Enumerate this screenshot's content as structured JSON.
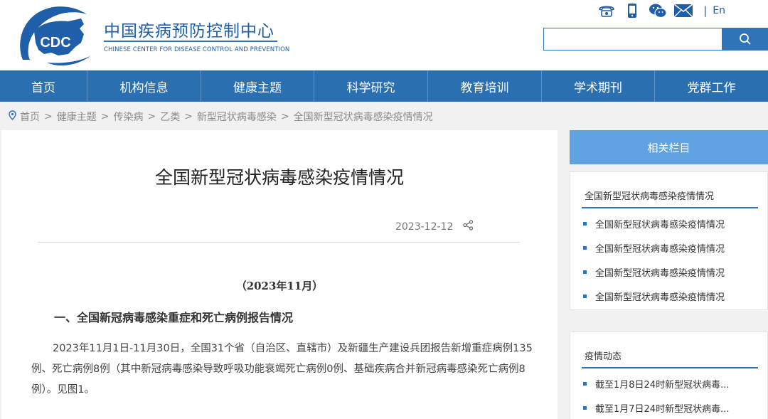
{
  "header": {
    "logo_text": "CDC",
    "org_name_cn": "中国疾病预防控制中心",
    "org_name_en": "CHINESE CENTER FOR DISEASE CONTROL AND PREVENTION",
    "lang_separator": "|",
    "lang_link": "En",
    "icons": [
      "phone-icon",
      "mobile-icon",
      "wechat-icon",
      "mail-icon"
    ],
    "search_placeholder": ""
  },
  "nav": {
    "items": [
      {
        "label": "首页"
      },
      {
        "label": "机构信息"
      },
      {
        "label": "健康主题"
      },
      {
        "label": "科学研究"
      },
      {
        "label": "教育培训"
      },
      {
        "label": "学术期刊"
      },
      {
        "label": "党群工作"
      }
    ]
  },
  "breadcrumb": {
    "separator": ">",
    "items": [
      "首页",
      "健康主题",
      "传染病",
      "乙类",
      "新型冠状病毒感染",
      "全国新型冠状病毒感染疫情情况"
    ]
  },
  "article": {
    "title": "全国新型冠状病毒感染疫情情况",
    "date": "2023-12-12",
    "subdate": "（2023年11月）",
    "section1_heading": "一、全国新冠病毒感染重症和死亡病例报告情况",
    "paragraph1": "2023年11月1日-11月30日，全国31个省（自治区、直辖市）及新疆生产建设兵团报告新增重症病例135例、死亡病例8例（其中新冠病毒感染导致呼吸功能衰竭死亡病例0例、基础疾病合并新冠病毒感染死亡病例8例）。见图1。"
  },
  "sidebar": {
    "header": "相关栏目",
    "box1": {
      "title": "全国新型冠状病毒感染疫情情况",
      "items": [
        "全国新型冠状病毒感染疫情情况",
        "全国新型冠状病毒感染疫情情况",
        "全国新型冠状病毒感染疫情情况",
        "全国新型冠状病毒感染疫情情况"
      ]
    },
    "box2": {
      "title": "疫情动态",
      "items": [
        "截至1月8日24时新型冠状病毒...",
        "截至1月7日24时新型冠状病毒..."
      ]
    }
  },
  "colors": {
    "brand_blue": "#2a6faf",
    "sidebar_head": "#5fa4e0",
    "breadcrumb_bg": "#f1f1f1"
  }
}
